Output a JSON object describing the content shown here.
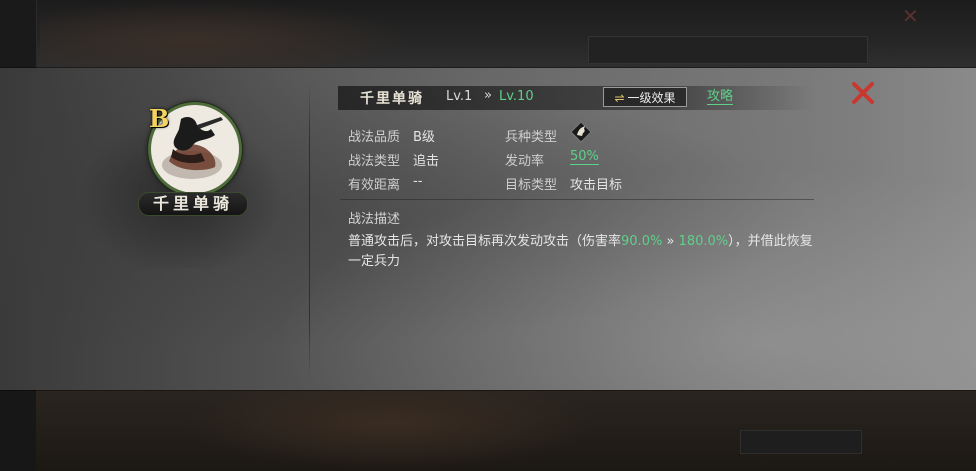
{
  "skill": {
    "grade": "B",
    "name": "千里单骑",
    "level_current": "Lv.1",
    "level_arrow": "»",
    "level_max": "Lv.10"
  },
  "header": {
    "effect_button_label": "一级效果",
    "effect_button_icon": "swap-arrows-icon",
    "strategy_link": "攻略",
    "close_icon": "close-x-icon"
  },
  "info": {
    "quality_label": "战法品质",
    "quality_value": "B级",
    "type_label": "战法类型",
    "type_value": "追击",
    "range_label": "有效距离",
    "range_value": "--",
    "troop_label": "兵种类型",
    "troop_icon": "cavalry-horse-icon",
    "rate_label": "发动率",
    "rate_value": "50%",
    "target_label": "目标类型",
    "target_value": "攻击目标"
  },
  "description": {
    "title": "战法描述",
    "part1": "普通攻击后，对攻击目标再次发动攻击（伤害率",
    "dmg_min": "90.0%",
    "arrow": " » ",
    "dmg_max": "180.0%",
    "part2": "），并借此恢复一定兵力"
  },
  "colors": {
    "accent_green": "#5fd08a",
    "grade_yellow": "#f4d35e",
    "close_red": "#c8382e",
    "portrait_ring": "#4f6b3c"
  }
}
